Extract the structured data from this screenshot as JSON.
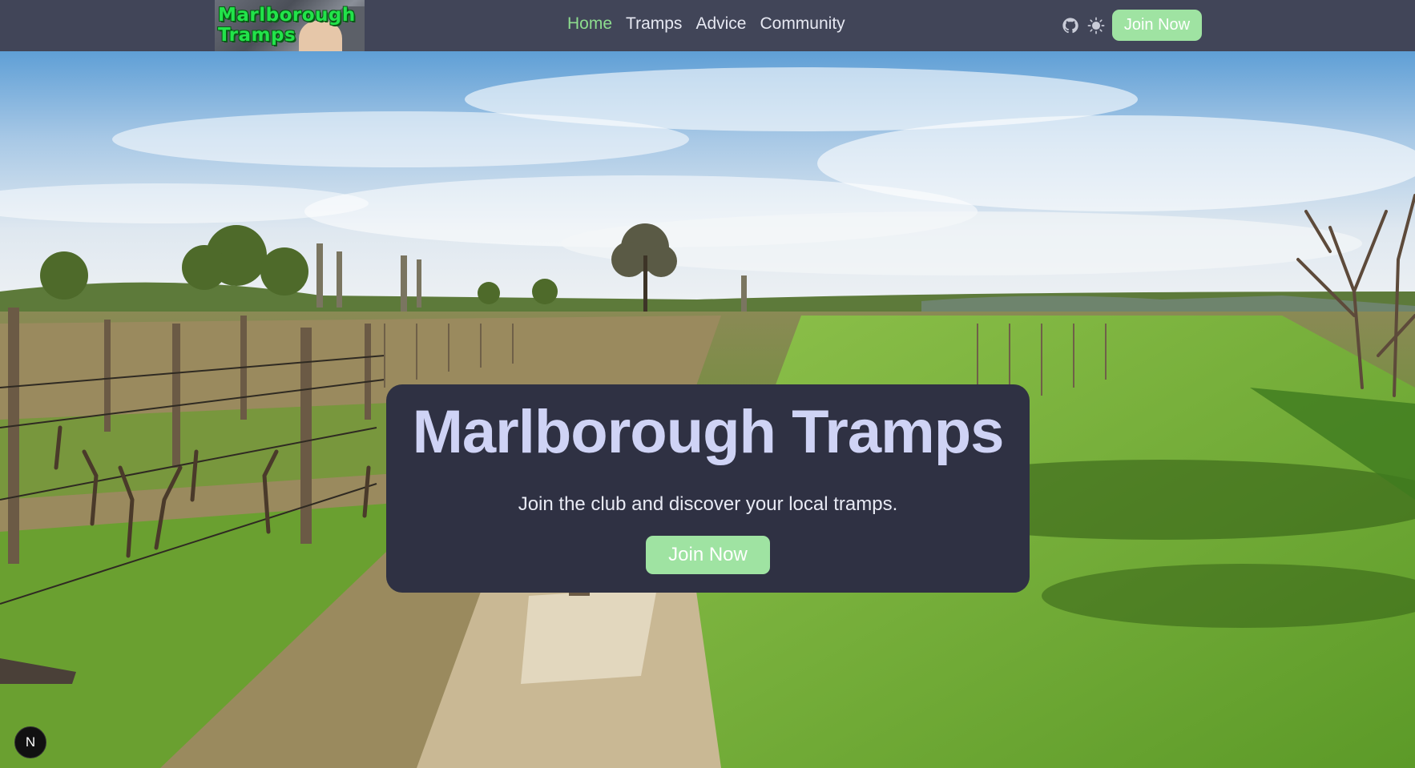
{
  "logo": {
    "line1": "Marlborough",
    "line2": "Tramps"
  },
  "nav": {
    "links": [
      {
        "label": "Home",
        "active": true
      },
      {
        "label": "Tramps",
        "active": false
      },
      {
        "label": "Advice",
        "active": false
      },
      {
        "label": "Community",
        "active": false
      }
    ],
    "join_label": "Join Now",
    "icons": [
      "github-icon",
      "theme-toggle-icon"
    ]
  },
  "hero": {
    "title": "Marlborough Tramps",
    "subtitle": "Join the club and discover your local tramps.",
    "join_label": "Join Now"
  },
  "badge": {
    "label": "N"
  },
  "colors": {
    "navbar": "#414558",
    "accent": "#9fe3a2",
    "active_link": "#8ddc8e",
    "card": "#2f3143",
    "title": "#cfd3f5"
  }
}
